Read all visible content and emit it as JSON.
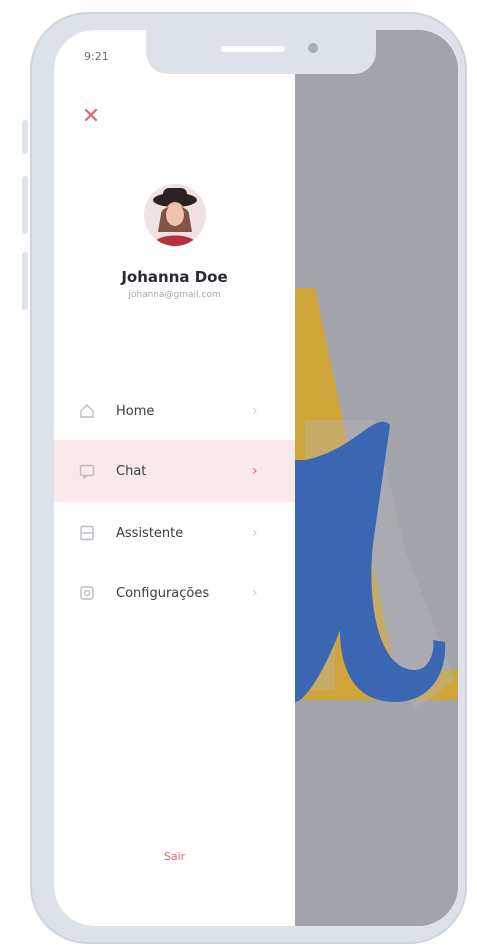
{
  "status_bar": {
    "time": "9:21"
  },
  "drawer": {
    "close_icon": "close-icon",
    "user": {
      "name": "Johanna Doe",
      "email": "johanna@gmail.com"
    },
    "menu": [
      {
        "label": "Home",
        "icon": "home-icon",
        "active": false
      },
      {
        "label": "Chat",
        "icon": "chat-icon",
        "active": true
      },
      {
        "label": "Assistente",
        "icon": "assistant-icon",
        "active": false
      },
      {
        "label": "Configurações",
        "icon": "settings-icon",
        "active": false
      }
    ],
    "logout_label": "Sair"
  },
  "colors": {
    "accent": "#e0656f",
    "active_bg": "#f9e9eb",
    "overlay": "#a3a4a9",
    "logo_blue": "#3b66b4",
    "logo_yellow": "#cfa53a"
  }
}
